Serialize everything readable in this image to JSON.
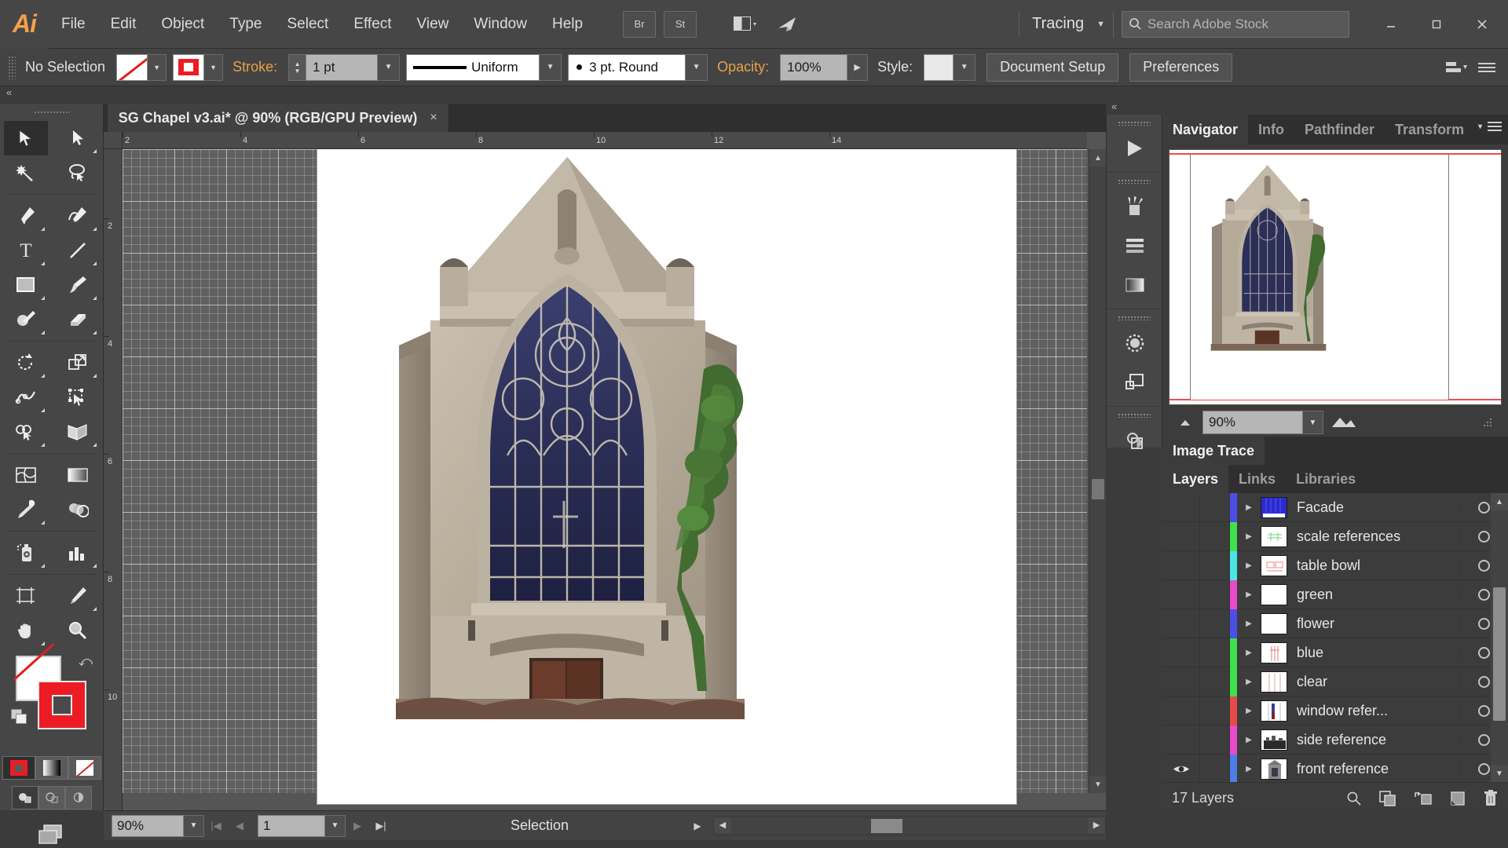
{
  "app": {
    "name": "Ai",
    "title": "Adobe Illustrator"
  },
  "menubar": {
    "items": [
      "File",
      "Edit",
      "Object",
      "Type",
      "Select",
      "Effect",
      "View",
      "Window",
      "Help"
    ],
    "bridge_label": "Br",
    "stock_label": "St",
    "arrange_icon": "arrange-documents-icon",
    "sync_icon": "sync-settings-icon",
    "workspace": "Tracing",
    "search_placeholder": "Search Adobe Stock",
    "window_buttons": [
      "minimize",
      "restore",
      "close"
    ]
  },
  "controlbar": {
    "selection_status": "No Selection",
    "fill_label": "fill-swatch",
    "stroke_swatch_label": "stroke-swatch",
    "stroke_label": "Stroke:",
    "stroke_weight": "1 pt",
    "stroke_profile": "Uniform",
    "brush_definition": "3 pt. Round",
    "opacity_label": "Opacity:",
    "opacity_value": "100%",
    "style_label": "Style:",
    "document_setup": "Document Setup",
    "preferences": "Preferences"
  },
  "document": {
    "tab_title": "SG Chapel v3.ai* @ 90% (RGB/GPU Preview)",
    "close_glyph": "×"
  },
  "toolbar": {
    "tools": [
      {
        "name": "selection-tool",
        "selected": true
      },
      {
        "name": "direct-selection-tool",
        "selected": false
      },
      {
        "name": "magic-wand-tool",
        "selected": false
      },
      {
        "name": "lasso-tool",
        "selected": false
      },
      {
        "name": "pen-tool",
        "selected": false
      },
      {
        "name": "curvature-tool",
        "selected": false
      },
      {
        "name": "type-tool",
        "selected": false
      },
      {
        "name": "line-segment-tool",
        "selected": false
      },
      {
        "name": "rectangle-tool",
        "selected": false
      },
      {
        "name": "paintbrush-tool",
        "selected": false
      },
      {
        "name": "shaper-tool",
        "selected": false
      },
      {
        "name": "eraser-tool",
        "selected": false
      },
      {
        "name": "rotate-tool",
        "selected": false
      },
      {
        "name": "scale-tool",
        "selected": false
      },
      {
        "name": "width-tool",
        "selected": false
      },
      {
        "name": "free-transform-tool",
        "selected": false
      },
      {
        "name": "shape-builder-tool",
        "selected": false
      },
      {
        "name": "perspective-grid-tool",
        "selected": false
      },
      {
        "name": "mesh-tool",
        "selected": false
      },
      {
        "name": "gradient-tool",
        "selected": false
      },
      {
        "name": "eyedropper-tool",
        "selected": false
      },
      {
        "name": "blend-tool",
        "selected": false
      },
      {
        "name": "symbol-sprayer-tool",
        "selected": false
      },
      {
        "name": "column-graph-tool",
        "selected": false
      },
      {
        "name": "artboard-tool",
        "selected": false
      },
      {
        "name": "slice-tool",
        "selected": false
      },
      {
        "name": "hand-tool",
        "selected": false
      },
      {
        "name": "zoom-tool",
        "selected": false
      }
    ],
    "fill_color": "#ffffff",
    "fill_is_none": true,
    "stroke_color": "#ed1c24",
    "draw_modes": [
      "draw-normal",
      "draw-behind",
      "draw-inside"
    ],
    "color_modes": [
      "color-mode",
      "gradient-mode",
      "none-mode"
    ],
    "screen_mode": "screen-mode-icon"
  },
  "canvas": {
    "artwork_name": "chapel-facade-photo",
    "ruler_units_top": [
      "2",
      "4",
      "6",
      "8",
      "10",
      "12",
      "14"
    ],
    "ruler_units_left": [
      "2",
      "4",
      "6",
      "8",
      "10"
    ]
  },
  "icondock": {
    "items": [
      {
        "name": "tool-panel-toggle-icon"
      },
      {
        "name": "brushes-icon"
      },
      {
        "name": "align-icon"
      },
      {
        "name": "gradient-icon"
      },
      {
        "name": "appearance-icon"
      },
      {
        "name": "artboards-icon"
      },
      {
        "name": "transparency-icon"
      }
    ]
  },
  "navigator": {
    "tabs": [
      "Navigator",
      "Info",
      "Pathfinder",
      "Transform"
    ],
    "active_tab": "Navigator",
    "zoom_value": "90%",
    "thumbnail_name": "navigator-thumbnail"
  },
  "image_trace": {
    "tab": "Image Trace"
  },
  "layers_panel": {
    "tabs": [
      "Layers",
      "Links",
      "Libraries"
    ],
    "active_tab": "Layers",
    "layer_count_label": "17 Layers",
    "footer_icons": [
      "locate-object-icon",
      "make-clipping-mask-icon",
      "create-new-sublayer-icon",
      "create-new-layer-icon",
      "delete-selection-icon"
    ],
    "layers": [
      {
        "name": "Facade",
        "color": "#4d4de8",
        "visible": false,
        "thumb": "facade",
        "expanded": false
      },
      {
        "name": "scale references",
        "color": "#3ee04b",
        "visible": false,
        "thumb": "scale",
        "expanded": false
      },
      {
        "name": "table bowl",
        "color": "#4ae6e6",
        "visible": false,
        "thumb": "table",
        "expanded": false
      },
      {
        "name": "green",
        "color": "#e84ac8",
        "visible": false,
        "thumb": "blank",
        "expanded": false
      },
      {
        "name": "flower",
        "color": "#4d4de8",
        "visible": false,
        "thumb": "blank",
        "expanded": false
      },
      {
        "name": "blue",
        "color": "#3ee04b",
        "visible": false,
        "thumb": "blue",
        "expanded": false
      },
      {
        "name": "clear",
        "color": "#3ee04b",
        "visible": false,
        "thumb": "clear",
        "expanded": false
      },
      {
        "name": "window refer...",
        "color": "#e84a4a",
        "visible": false,
        "thumb": "window",
        "expanded": false
      },
      {
        "name": "side reference",
        "color": "#e84ac8",
        "visible": false,
        "thumb": "side",
        "expanded": false
      },
      {
        "name": "front reference",
        "color": "#4d7de8",
        "visible": true,
        "thumb": "front",
        "expanded": false
      }
    ]
  },
  "statusbar": {
    "zoom_value": "90%",
    "page_number": "1",
    "status_text": "Selection",
    "first_icon": "first-artboard-icon",
    "prev_icon": "previous-artboard-icon",
    "next_icon": "next-artboard-icon",
    "last_icon": "last-artboard-icon"
  },
  "colors": {
    "chrome": "#464646",
    "panel": "#3c3c3c",
    "accent_orange": "#e8a24a",
    "stroke_red": "#ed1c24"
  }
}
